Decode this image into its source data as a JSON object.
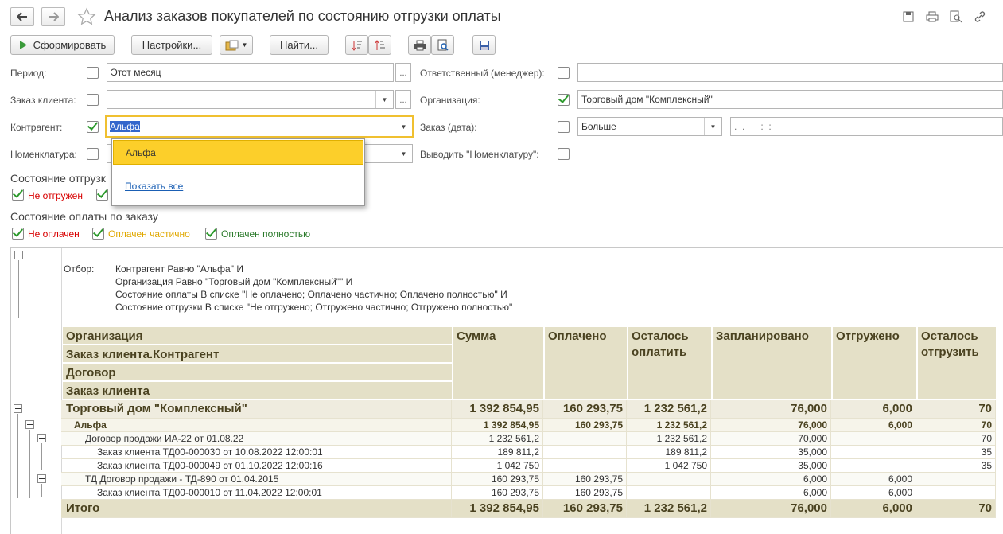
{
  "window": {
    "title": "Анализ заказов покупателей по состоянию отгрузки оплаты"
  },
  "toolbar": {
    "generate_label": "Сформировать",
    "settings_label": "Настройки...",
    "find_label": "Найти..."
  },
  "filters": {
    "period_label": "Период:",
    "period_value": "Этот месяц",
    "dots": "...",
    "order_label": "Заказ клиента:",
    "counterparty_label": "Контрагент:",
    "counterparty_value": "Альфа",
    "nomenclature_label": "Номенклатура:",
    "responsible_label": "Ответственный (менеджер):",
    "organization_label": "Организация:",
    "organization_value": "Торговый дом \"Комплексный\"",
    "order_date_label": "Заказ (дата):",
    "order_date_cmp": "Больше",
    "order_date_value": ".  .      :  :",
    "show_nom_label": "Выводить \"Номенклатуру\":"
  },
  "dropdown": {
    "item": "Альфа",
    "show_all": "Показать все"
  },
  "shipment": {
    "title": "Состояние отгрузки по заказу",
    "title_visible": "Состояние отгрузк",
    "not_shipped": "Не отгружен"
  },
  "payment": {
    "title": "Состояние оплаты по заказу",
    "not_paid": "Не оплачен",
    "partially": "Оплачен частично",
    "fully": "Оплачен полностью"
  },
  "report": {
    "filter_label": "Отбор:",
    "filter_lines": [
      "Контрагент Равно \"Альфа\" И",
      "Организация Равно \"Торговый дом \"Комплексный\"\" И",
      "Состояние оплаты В списке \"Не оплачено; Оплачено частично; Оплачено полностью\" И",
      "Состояние отгрузки В списке \"Не отгружено; Отгружено частично; Отгружено полностью\""
    ],
    "headers": {
      "group": [
        "Организация",
        "Заказ клиента.Контрагент",
        "Договор",
        "Заказ клиента"
      ],
      "sum": "Сумма",
      "paid": "Оплачено",
      "to_pay": "Осталось оплатить",
      "planned": "Запланировано",
      "shipped": "Отгружено",
      "to_ship": "Осталось отгрузить"
    },
    "rows": [
      {
        "name": "Торговый дом \"Комплексный\"",
        "sum": "1 392 854,95",
        "paid": "160 293,75",
        "to_pay": "1 232 561,2",
        "planned": "76,000",
        "shipped": "6,000",
        "to_ship": "70"
      },
      {
        "name": "Альфа",
        "sum": "1 392 854,95",
        "paid": "160 293,75",
        "to_pay": "1 232 561,2",
        "planned": "76,000",
        "shipped": "6,000",
        "to_ship": "70"
      },
      {
        "name": "Договор продажи ИА-22 от 01.08.22",
        "sum": "1 232 561,2",
        "paid": "",
        "to_pay": "1 232 561,2",
        "planned": "70,000",
        "shipped": "",
        "to_ship": "70"
      },
      {
        "name": "Заказ клиента ТД00-000030 от 10.08.2022 12:00:01",
        "sum": "189 811,2",
        "paid": "",
        "to_pay": "189 811,2",
        "planned": "35,000",
        "shipped": "",
        "to_ship": "35"
      },
      {
        "name": "Заказ клиента ТД00-000049 от 01.10.2022 12:00:16",
        "sum": "1 042 750",
        "paid": "",
        "to_pay": "1 042 750",
        "planned": "35,000",
        "shipped": "",
        "to_ship": "35"
      },
      {
        "name": "ТД Договор продажи - ТД-890 от 01.04.2015",
        "sum": "160 293,75",
        "paid": "160 293,75",
        "to_pay": "",
        "planned": "6,000",
        "shipped": "6,000",
        "to_ship": ""
      },
      {
        "name": "Заказ клиента ТД00-000010 от 11.04.2022 12:00:01",
        "sum": "160 293,75",
        "paid": "160 293,75",
        "to_pay": "",
        "planned": "6,000",
        "shipped": "6,000",
        "to_ship": ""
      }
    ],
    "total": {
      "name": "Итого",
      "sum": "1 392 854,95",
      "paid": "160 293,75",
      "to_pay": "1 232 561,2",
      "planned": "76,000",
      "shipped": "6,000",
      "to_ship": "70"
    }
  },
  "colors": {
    "header_bg": "#e4e0c7",
    "selected": "#fccf2a",
    "not_red": "#d80000",
    "partial_yellow": "#e0a800",
    "full_green": "#2b7a2b"
  }
}
